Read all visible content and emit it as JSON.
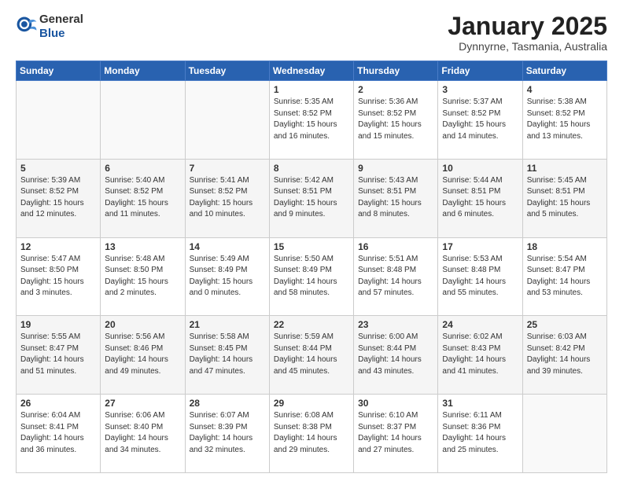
{
  "header": {
    "logo": {
      "general": "General",
      "blue": "Blue"
    },
    "title": "January 2025",
    "location": "Dynnyrne, Tasmania, Australia"
  },
  "weekdays": [
    "Sunday",
    "Monday",
    "Tuesday",
    "Wednesday",
    "Thursday",
    "Friday",
    "Saturday"
  ],
  "weeks": [
    [
      {
        "day": "",
        "sunrise": "",
        "sunset": "",
        "daylight": ""
      },
      {
        "day": "",
        "sunrise": "",
        "sunset": "",
        "daylight": ""
      },
      {
        "day": "",
        "sunrise": "",
        "sunset": "",
        "daylight": ""
      },
      {
        "day": "1",
        "sunrise": "Sunrise: 5:35 AM",
        "sunset": "Sunset: 8:52 PM",
        "daylight": "Daylight: 15 hours and 16 minutes."
      },
      {
        "day": "2",
        "sunrise": "Sunrise: 5:36 AM",
        "sunset": "Sunset: 8:52 PM",
        "daylight": "Daylight: 15 hours and 15 minutes."
      },
      {
        "day": "3",
        "sunrise": "Sunrise: 5:37 AM",
        "sunset": "Sunset: 8:52 PM",
        "daylight": "Daylight: 15 hours and 14 minutes."
      },
      {
        "day": "4",
        "sunrise": "Sunrise: 5:38 AM",
        "sunset": "Sunset: 8:52 PM",
        "daylight": "Daylight: 15 hours and 13 minutes."
      }
    ],
    [
      {
        "day": "5",
        "sunrise": "Sunrise: 5:39 AM",
        "sunset": "Sunset: 8:52 PM",
        "daylight": "Daylight: 15 hours and 12 minutes."
      },
      {
        "day": "6",
        "sunrise": "Sunrise: 5:40 AM",
        "sunset": "Sunset: 8:52 PM",
        "daylight": "Daylight: 15 hours and 11 minutes."
      },
      {
        "day": "7",
        "sunrise": "Sunrise: 5:41 AM",
        "sunset": "Sunset: 8:52 PM",
        "daylight": "Daylight: 15 hours and 10 minutes."
      },
      {
        "day": "8",
        "sunrise": "Sunrise: 5:42 AM",
        "sunset": "Sunset: 8:51 PM",
        "daylight": "Daylight: 15 hours and 9 minutes."
      },
      {
        "day": "9",
        "sunrise": "Sunrise: 5:43 AM",
        "sunset": "Sunset: 8:51 PM",
        "daylight": "Daylight: 15 hours and 8 minutes."
      },
      {
        "day": "10",
        "sunrise": "Sunrise: 5:44 AM",
        "sunset": "Sunset: 8:51 PM",
        "daylight": "Daylight: 15 hours and 6 minutes."
      },
      {
        "day": "11",
        "sunrise": "Sunrise: 5:45 AM",
        "sunset": "Sunset: 8:51 PM",
        "daylight": "Daylight: 15 hours and 5 minutes."
      }
    ],
    [
      {
        "day": "12",
        "sunrise": "Sunrise: 5:47 AM",
        "sunset": "Sunset: 8:50 PM",
        "daylight": "Daylight: 15 hours and 3 minutes."
      },
      {
        "day": "13",
        "sunrise": "Sunrise: 5:48 AM",
        "sunset": "Sunset: 8:50 PM",
        "daylight": "Daylight: 15 hours and 2 minutes."
      },
      {
        "day": "14",
        "sunrise": "Sunrise: 5:49 AM",
        "sunset": "Sunset: 8:49 PM",
        "daylight": "Daylight: 15 hours and 0 minutes."
      },
      {
        "day": "15",
        "sunrise": "Sunrise: 5:50 AM",
        "sunset": "Sunset: 8:49 PM",
        "daylight": "Daylight: 14 hours and 58 minutes."
      },
      {
        "day": "16",
        "sunrise": "Sunrise: 5:51 AM",
        "sunset": "Sunset: 8:48 PM",
        "daylight": "Daylight: 14 hours and 57 minutes."
      },
      {
        "day": "17",
        "sunrise": "Sunrise: 5:53 AM",
        "sunset": "Sunset: 8:48 PM",
        "daylight": "Daylight: 14 hours and 55 minutes."
      },
      {
        "day": "18",
        "sunrise": "Sunrise: 5:54 AM",
        "sunset": "Sunset: 8:47 PM",
        "daylight": "Daylight: 14 hours and 53 minutes."
      }
    ],
    [
      {
        "day": "19",
        "sunrise": "Sunrise: 5:55 AM",
        "sunset": "Sunset: 8:47 PM",
        "daylight": "Daylight: 14 hours and 51 minutes."
      },
      {
        "day": "20",
        "sunrise": "Sunrise: 5:56 AM",
        "sunset": "Sunset: 8:46 PM",
        "daylight": "Daylight: 14 hours and 49 minutes."
      },
      {
        "day": "21",
        "sunrise": "Sunrise: 5:58 AM",
        "sunset": "Sunset: 8:45 PM",
        "daylight": "Daylight: 14 hours and 47 minutes."
      },
      {
        "day": "22",
        "sunrise": "Sunrise: 5:59 AM",
        "sunset": "Sunset: 8:44 PM",
        "daylight": "Daylight: 14 hours and 45 minutes."
      },
      {
        "day": "23",
        "sunrise": "Sunrise: 6:00 AM",
        "sunset": "Sunset: 8:44 PM",
        "daylight": "Daylight: 14 hours and 43 minutes."
      },
      {
        "day": "24",
        "sunrise": "Sunrise: 6:02 AM",
        "sunset": "Sunset: 8:43 PM",
        "daylight": "Daylight: 14 hours and 41 minutes."
      },
      {
        "day": "25",
        "sunrise": "Sunrise: 6:03 AM",
        "sunset": "Sunset: 8:42 PM",
        "daylight": "Daylight: 14 hours and 39 minutes."
      }
    ],
    [
      {
        "day": "26",
        "sunrise": "Sunrise: 6:04 AM",
        "sunset": "Sunset: 8:41 PM",
        "daylight": "Daylight: 14 hours and 36 minutes."
      },
      {
        "day": "27",
        "sunrise": "Sunrise: 6:06 AM",
        "sunset": "Sunset: 8:40 PM",
        "daylight": "Daylight: 14 hours and 34 minutes."
      },
      {
        "day": "28",
        "sunrise": "Sunrise: 6:07 AM",
        "sunset": "Sunset: 8:39 PM",
        "daylight": "Daylight: 14 hours and 32 minutes."
      },
      {
        "day": "29",
        "sunrise": "Sunrise: 6:08 AM",
        "sunset": "Sunset: 8:38 PM",
        "daylight": "Daylight: 14 hours and 29 minutes."
      },
      {
        "day": "30",
        "sunrise": "Sunrise: 6:10 AM",
        "sunset": "Sunset: 8:37 PM",
        "daylight": "Daylight: 14 hours and 27 minutes."
      },
      {
        "day": "31",
        "sunrise": "Sunrise: 6:11 AM",
        "sunset": "Sunset: 8:36 PM",
        "daylight": "Daylight: 14 hours and 25 minutes."
      },
      {
        "day": "",
        "sunrise": "",
        "sunset": "",
        "daylight": ""
      }
    ]
  ]
}
